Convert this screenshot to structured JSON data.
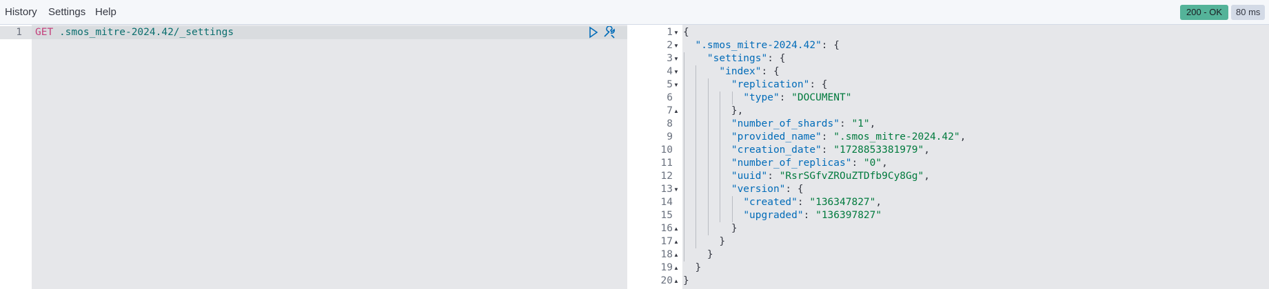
{
  "menu": {
    "history": "History",
    "settings": "Settings",
    "help": "Help"
  },
  "status": {
    "code": "200 - OK",
    "time": "80 ms",
    "ok_color": "#54b399"
  },
  "request": {
    "line_number": "1",
    "method": "GET",
    "path": ".smos_mitre-2024.42/_settings",
    "run_icon": "play-icon",
    "settings_icon": "wrench-icon"
  },
  "response": {
    "line_numbers": [
      "1",
      "2",
      "3",
      "4",
      "5",
      "6",
      "7",
      "8",
      "9",
      "10",
      "11",
      "12",
      "13",
      "14",
      "15",
      "16",
      "17",
      "18",
      "19",
      "20"
    ],
    "lines": [
      "{",
      "  \".smos_mitre-2024.42\": {",
      "    \"settings\": {",
      "      \"index\": {",
      "        \"replication\": {",
      "          \"type\": \"DOCUMENT\"",
      "        },",
      "        \"number_of_shards\": \"1\",",
      "        \"provided_name\": \".smos_mitre-2024.42\",",
      "        \"creation_date\": \"1728853381979\",",
      "        \"number_of_replicas\": \"0\",",
      "        \"uuid\": \"RsrSGfvZROuZTDfb9Cy8Gg\",",
      "        \"version\": {",
      "          \"created\": \"136347827\",",
      "          \"upgraded\": \"136397827\"",
      "        }",
      "      }",
      "    }",
      "  }",
      "}"
    ]
  }
}
